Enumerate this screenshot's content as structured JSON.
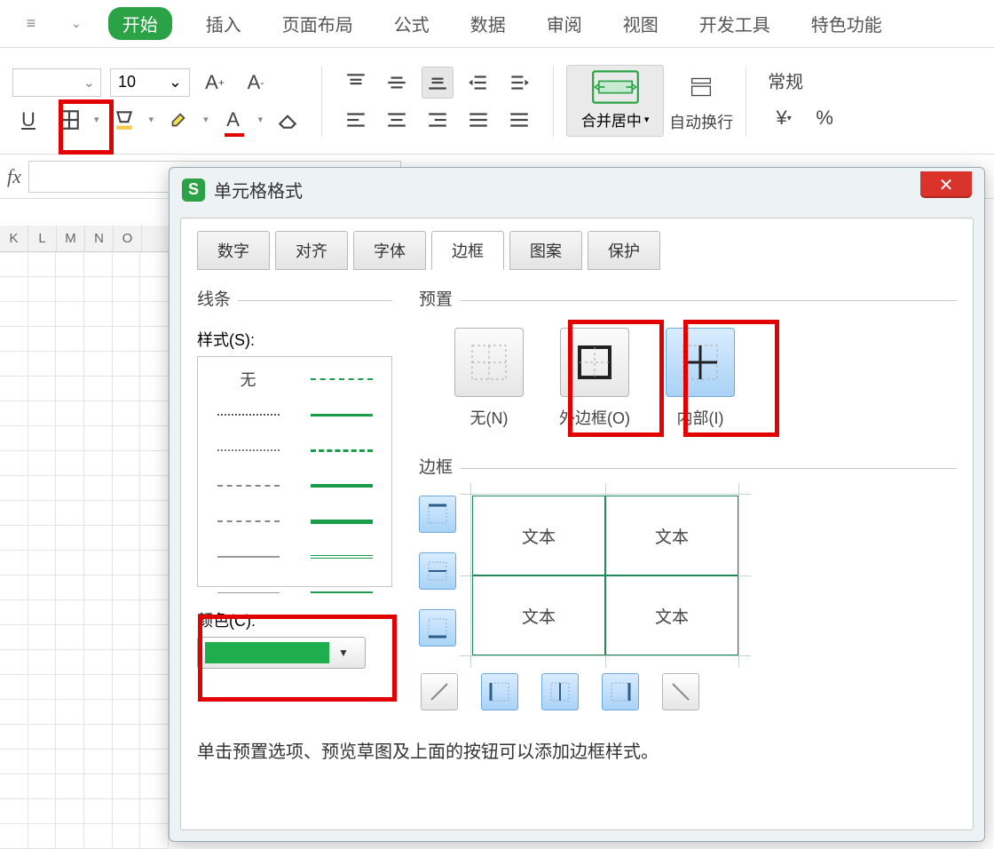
{
  "menu": {
    "tabs": [
      "开始",
      "插入",
      "页面布局",
      "公式",
      "数据",
      "审阅",
      "视图",
      "开发工具",
      "特色功能"
    ],
    "active": "开始"
  },
  "toolbar": {
    "font_size": "10",
    "merge_label": "合并居中",
    "wrap_label": "自动换行",
    "number_format": "常规"
  },
  "fx": {
    "label": "fx"
  },
  "columns": [
    "K",
    "L",
    "M",
    "N",
    "O"
  ],
  "dialog": {
    "title": "单元格格式",
    "tabs": [
      "数字",
      "对齐",
      "字体",
      "边框",
      "图案",
      "保护"
    ],
    "active_tab": "边框",
    "line_section": "线条",
    "style_label": "样式(S):",
    "style_none": "无",
    "color_label": "颜色(C):",
    "preset_section": "预置",
    "presets": [
      {
        "label": "无(N)",
        "variant": "none"
      },
      {
        "label": "外边框(O)",
        "variant": "outline"
      },
      {
        "label": "内部(I)",
        "variant": "inner"
      }
    ],
    "border_section": "边框",
    "sample_text": "文本",
    "hint": "单击预置选项、预览草图及上面的按钮可以添加边框样式。"
  }
}
